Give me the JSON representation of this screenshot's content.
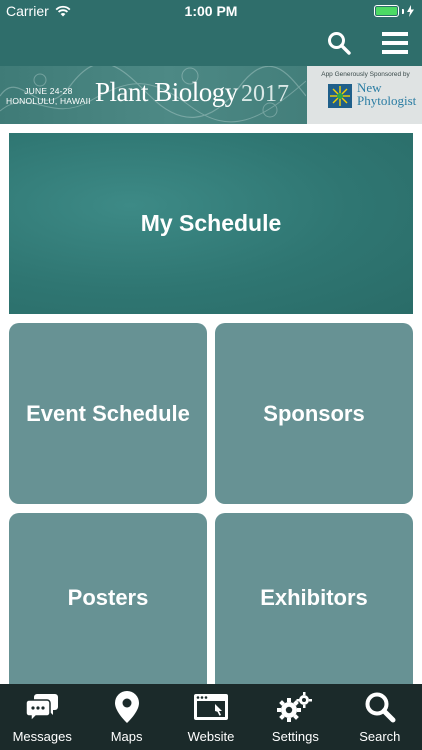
{
  "status_bar": {
    "carrier": "Carrier",
    "time": "1:00 PM",
    "battery_color": "#4cd964"
  },
  "nav": {
    "search_icon": "search-icon",
    "menu_icon": "hamburger-menu-icon",
    "background": "#2f6e6b"
  },
  "banner": {
    "dates_line1": "JUNE 24-28",
    "dates_line2": "HONOLULU, HAWAII",
    "title": "Plant Biology",
    "year": "2017",
    "sponsor_label": "App Generously Sponsored by",
    "sponsor_name_line1": "New",
    "sponsor_name_line2": "Phytologist"
  },
  "tiles": {
    "my_schedule": "My Schedule",
    "event_schedule": "Event Schedule",
    "sponsors": "Sponsors",
    "posters": "Posters",
    "exhibitors": "Exhibitors",
    "tile_color": "#679294",
    "hero_color": "#2f7672"
  },
  "tabbar": {
    "items": [
      {
        "label": "Messages",
        "icon": "chat-bubbles-icon"
      },
      {
        "label": "Maps",
        "icon": "map-pin-icon"
      },
      {
        "label": "Website",
        "icon": "browser-window-icon"
      },
      {
        "label": "Settings",
        "icon": "gears-icon"
      },
      {
        "label": "Search",
        "icon": "search-icon"
      }
    ],
    "background": "#1b2a2a"
  }
}
